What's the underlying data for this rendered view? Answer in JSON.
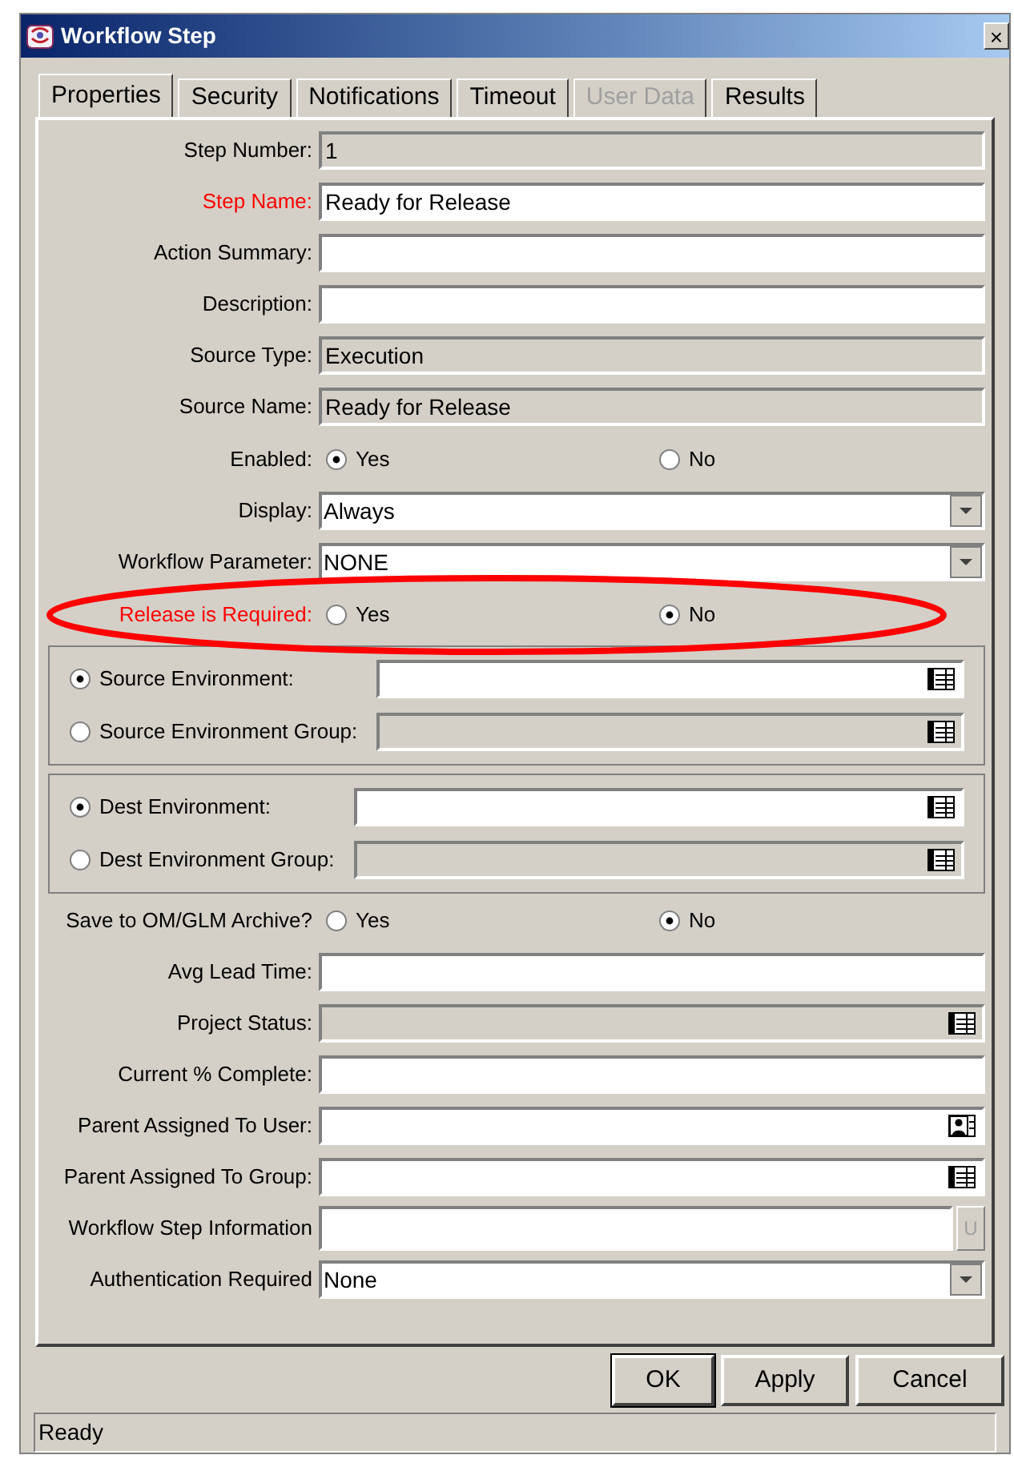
{
  "window": {
    "title": "Workflow Step",
    "close": "×"
  },
  "tabs": [
    {
      "label": "Properties",
      "selected": true,
      "disabled": false
    },
    {
      "label": "Security",
      "selected": false,
      "disabled": false
    },
    {
      "label": "Notifications",
      "selected": false,
      "disabled": false
    },
    {
      "label": "Timeout",
      "selected": false,
      "disabled": false
    },
    {
      "label": "User Data",
      "selected": false,
      "disabled": true
    },
    {
      "label": "Results",
      "selected": false,
      "disabled": false
    }
  ],
  "rows": [
    {
      "kind": "text",
      "label": "Step Number:",
      "value": "1",
      "readonly": true,
      "required": false
    },
    {
      "kind": "text",
      "label": "Step Name:",
      "value": "Ready for Release",
      "readonly": false,
      "required": true
    },
    {
      "kind": "text",
      "label": "Action Summary:",
      "readonly": false,
      "required": false
    },
    {
      "kind": "text",
      "label": "Description:",
      "readonly": false,
      "required": false
    },
    {
      "kind": "text",
      "label": "Source Type:",
      "value": "Execution",
      "readonly": true,
      "required": false
    },
    {
      "kind": "text",
      "label": "Source Name:",
      "value": "Ready for Release",
      "readonly": true,
      "required": false
    },
    {
      "kind": "radio",
      "label": "Enabled:",
      "required": false,
      "circled": false,
      "options": [
        {
          "label": "Yes",
          "selected": true
        },
        {
          "label": "No",
          "selected": false
        }
      ]
    },
    {
      "kind": "select",
      "label": "Display:",
      "value": "Always",
      "required": false
    },
    {
      "kind": "select",
      "label": "Workflow Parameter:",
      "value": "NONE",
      "required": false
    },
    {
      "kind": "radio",
      "label": "Release is Required:",
      "required": true,
      "circled": true,
      "options": [
        {
          "label": "Yes",
          "selected": false
        },
        {
          "label": "No",
          "selected": true
        }
      ]
    },
    {
      "kind": "group",
      "options": [
        {
          "label": "Source Environment:",
          "selected": true,
          "readonly": false
        },
        {
          "label": "Source Environment Group:",
          "selected": false,
          "readonly": true
        }
      ]
    },
    {
      "kind": "group",
      "options": [
        {
          "label": "Dest Environment:",
          "selected": true,
          "readonly": false
        },
        {
          "label": "Dest Environment Group:",
          "selected": false,
          "readonly": true
        }
      ]
    },
    {
      "kind": "radio",
      "label": "Save to OM/GLM Archive?",
      "required": false,
      "circled": false,
      "options": [
        {
          "label": "Yes",
          "selected": false
        },
        {
          "label": "No",
          "selected": true
        }
      ]
    },
    {
      "kind": "text",
      "label": "Avg Lead Time:",
      "readonly": false,
      "required": false
    },
    {
      "kind": "lookup",
      "label": "Project Status:",
      "readonly": true,
      "required": false
    },
    {
      "kind": "text",
      "label": "Current % Complete:",
      "readonly": false,
      "required": false
    },
    {
      "kind": "user",
      "label": "Parent Assigned To User:",
      "readonly": false,
      "required": false
    },
    {
      "kind": "lookup",
      "label": "Parent Assigned To Group:",
      "readonly": false,
      "required": false
    },
    {
      "kind": "info",
      "label": "Workflow Step Information",
      "button": "U",
      "required": false
    },
    {
      "kind": "select",
      "label": "Authentication Required",
      "value": "None",
      "required": false
    }
  ],
  "buttons": [
    "OK",
    "Apply",
    "Cancel"
  ],
  "status_bar": "Ready"
}
